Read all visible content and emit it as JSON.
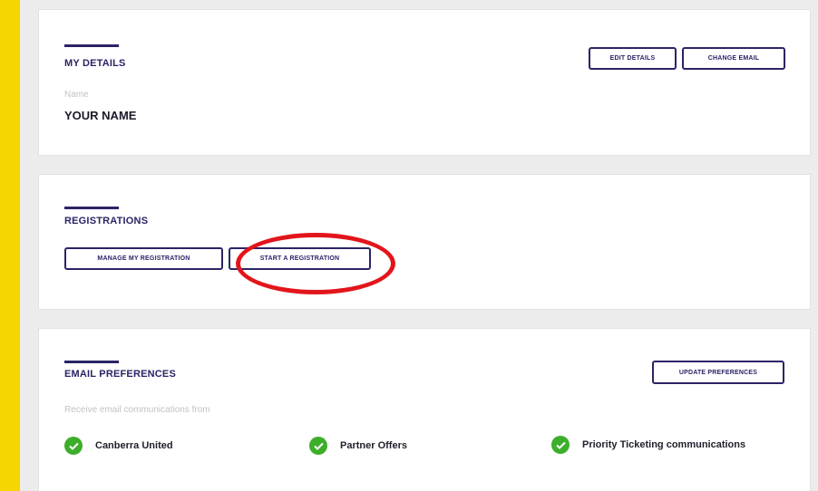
{
  "colors": {
    "accent": "#2a2466",
    "page_border": "#f6d600",
    "highlight": "#e2151b",
    "check": "#3dae2b"
  },
  "details": {
    "title": "MY DETAILS",
    "edit_label": "EDIT DETAILS",
    "change_email_label": "CHANGE EMAIL",
    "name_label": "Name",
    "name_value": "YOUR NAME"
  },
  "registrations": {
    "title": "REGISTRATIONS",
    "manage_label": "MANAGE MY REGISTRATION",
    "start_label": "START A REGISTRATION"
  },
  "email": {
    "title": "EMAIL PREFERENCES",
    "update_label": "UPDATE PREFERENCES",
    "subtitle": "Receive email communications from",
    "prefs": [
      {
        "label": "Canberra United",
        "icon": "check-circle-icon"
      },
      {
        "label": "Partner Offers",
        "icon": "check-circle-icon"
      },
      {
        "label": "Priority Ticketing communications",
        "icon": "check-circle-icon"
      }
    ]
  }
}
